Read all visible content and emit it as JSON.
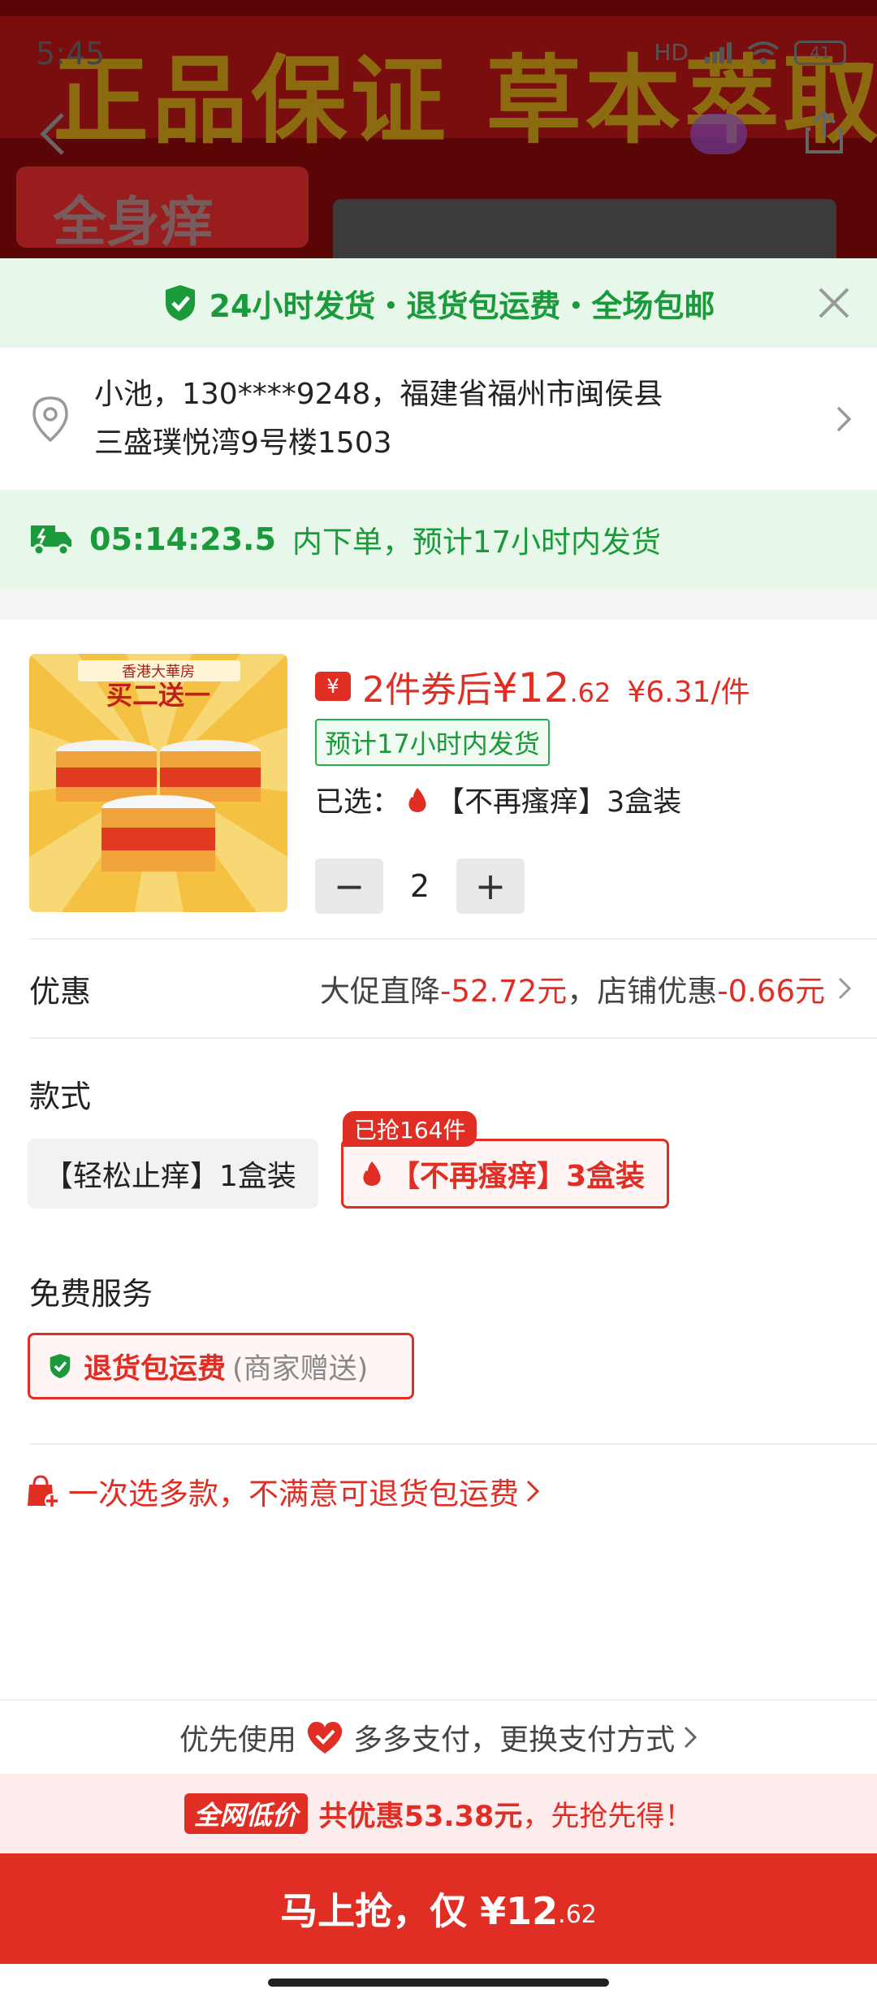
{
  "status_bar": {
    "time": "5:45",
    "battery": "41",
    "network": "HD"
  },
  "background_banner": {
    "headline": "正品保证 草本萃取",
    "pill": "全身痒"
  },
  "notice": {
    "text": "24小时发货・退货包运费・全场包邮"
  },
  "address": {
    "line1": "小池，130****9248，福建省福州市闽侯县",
    "line2": "三盛璞悦湾9号楼1503"
  },
  "shipping": {
    "countdown": "05:14:23.5",
    "text": "内下单，预计17小时内发货"
  },
  "product": {
    "image_text": "买二送一",
    "brand_text": "香港大華房",
    "price_label": "2件券后",
    "price_main": "¥12",
    "price_decimal": ".62",
    "unit_price": "¥6.31/件",
    "ship_tag": "预计17小时内发货",
    "selected_label": "已选：",
    "selected_value": "【不再瘙痒】3盒装",
    "quantity": "2",
    "minus": "−",
    "plus": "+"
  },
  "promo": {
    "title": "优惠",
    "label1": "大促直降",
    "value1": "-52.72元",
    "sep": "，",
    "label2": "店铺优惠",
    "value2": "-0.66元"
  },
  "style": {
    "title": "款式",
    "options": [
      {
        "label": "【轻松止痒】1盒装"
      },
      {
        "label": "【不再瘙痒】3盒装",
        "badge": "已抢164件"
      }
    ]
  },
  "service": {
    "title": "免费服务",
    "name": "退货包运费",
    "note": "(商家赠送)"
  },
  "multi": {
    "text": "一次选多款，不满意可退货包运费"
  },
  "payment": {
    "prefix": "优先使用",
    "text": "多多支付，更换支付方式"
  },
  "deal": {
    "tag": "全网低价",
    "text": "共优惠53.38元",
    "suffix": "，先抢先得！"
  },
  "buy": {
    "label": "马上抢，仅 ¥12",
    "decimal": ".62"
  },
  "colors": {
    "accent_red": "#e02e24",
    "green": "#1a9a3a",
    "green_bg": "#e7f8ea"
  }
}
